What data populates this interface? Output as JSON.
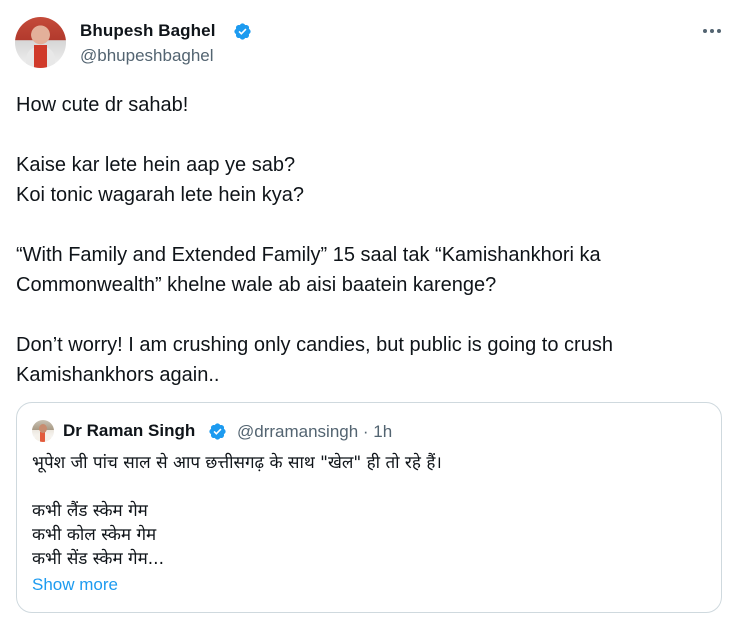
{
  "tweet": {
    "author_name": "Bhupesh Baghel",
    "author_handle": "@bhupeshbaghel",
    "lines": [
      "How cute dr sahab!",
      "",
      "Kaise kar lete hein aap ye sab?",
      "Koi tonic wagarah lete hein kya?",
      "",
      "“With Family and Extended Family” 15 saal tak “Kamishankhori ka",
      "Commonwealth” khelne wale ab aisi baatein karenge?",
      "",
      "Don’t worry! I am crushing only candies, but public is going to crush",
      "Kamishankhors again.."
    ]
  },
  "quoted": {
    "author_name": "Dr Raman Singh",
    "author_handle_time": "@drramansingh · 1h",
    "lines": [
      "भूपेश जी पांच साल से आप छत्तीसगढ़ के साथ \"खेल\" ही तो रहे हैं।",
      "",
      "कभी लैंड स्केम गेम",
      "कभी कोल स्केम गेम",
      "कभी सेंड स्केम गेम..."
    ],
    "show_more_label": "Show more"
  },
  "colors": {
    "text": "#0f1419",
    "secondary": "#536471",
    "link": "#1d9bf0",
    "verified": "#1d9bf0",
    "border": "#cfd9de"
  },
  "icons": {
    "verified": "verified-badge-icon",
    "more": "more-horizontal-icon"
  }
}
